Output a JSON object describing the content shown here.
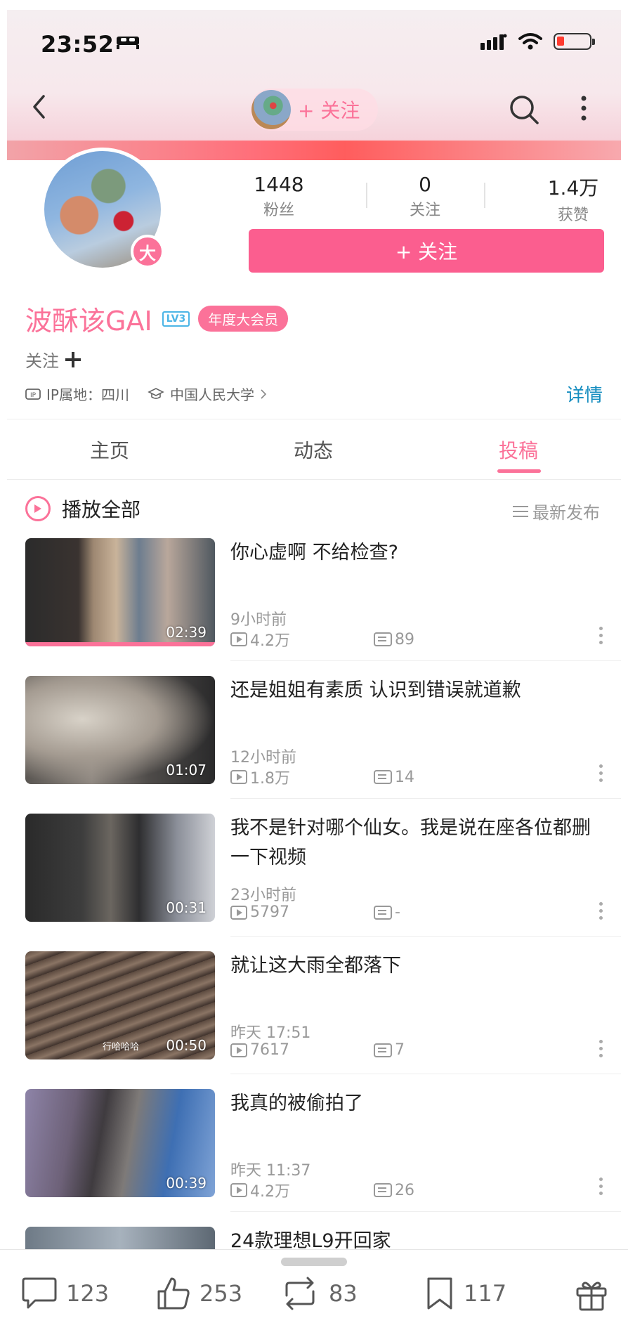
{
  "status_bar": {
    "time": "23:52"
  },
  "nav": {
    "follow_pill_label": "+ 关注"
  },
  "profile": {
    "avatar_badge": "大",
    "stats": [
      {
        "value": "1448",
        "label": "粉丝"
      },
      {
        "value": "0",
        "label": "关注"
      },
      {
        "value": "1.4万",
        "label": "获赞"
      }
    ],
    "follow_button": "+ 关注",
    "username": "波酥该GAI",
    "level_badge": "LV3",
    "vip_badge": "年度大会员",
    "follow_text": "关注",
    "ip_location": "IP属地：四川",
    "school": "中国人民大学",
    "detail_link": "详情"
  },
  "tabs": [
    {
      "label": "主页"
    },
    {
      "label": "动态"
    },
    {
      "label": "投稿"
    }
  ],
  "video_list": {
    "play_all": "播放全部",
    "sort_label": "最新发布",
    "items": [
      {
        "title": "你心虚啊 不给检查?",
        "time": "9小时前",
        "plays": "4.2万",
        "danmaku": "89",
        "duration": "02:39"
      },
      {
        "title": "还是姐姐有素质 认识到错误就道歉",
        "time": "12小时前",
        "plays": "1.8万",
        "danmaku": "14",
        "duration": "01:07"
      },
      {
        "title": "我不是针对哪个仙女。我是说在座各位都删一下视频",
        "time": "23小时前",
        "plays": "5797",
        "danmaku": "-",
        "duration": "00:31"
      },
      {
        "title": "就让这大雨全都落下",
        "time": "昨天 17:51",
        "plays": "7617",
        "danmaku": "7",
        "duration": "00:50",
        "thumb_caption": "行哈哈哈"
      },
      {
        "title": "我真的被偷拍了",
        "time": "昨天 11:37",
        "plays": "4.2万",
        "danmaku": "26",
        "duration": "00:39"
      },
      {
        "title": "24款理想L9开回家"
      }
    ]
  },
  "bottom_bar": {
    "comments": "123",
    "likes": "253",
    "reposts": "83",
    "favorites": "117"
  },
  "colors": {
    "accent": "#fb7299",
    "link": "#178ec0",
    "button": "#fb5e8f"
  }
}
